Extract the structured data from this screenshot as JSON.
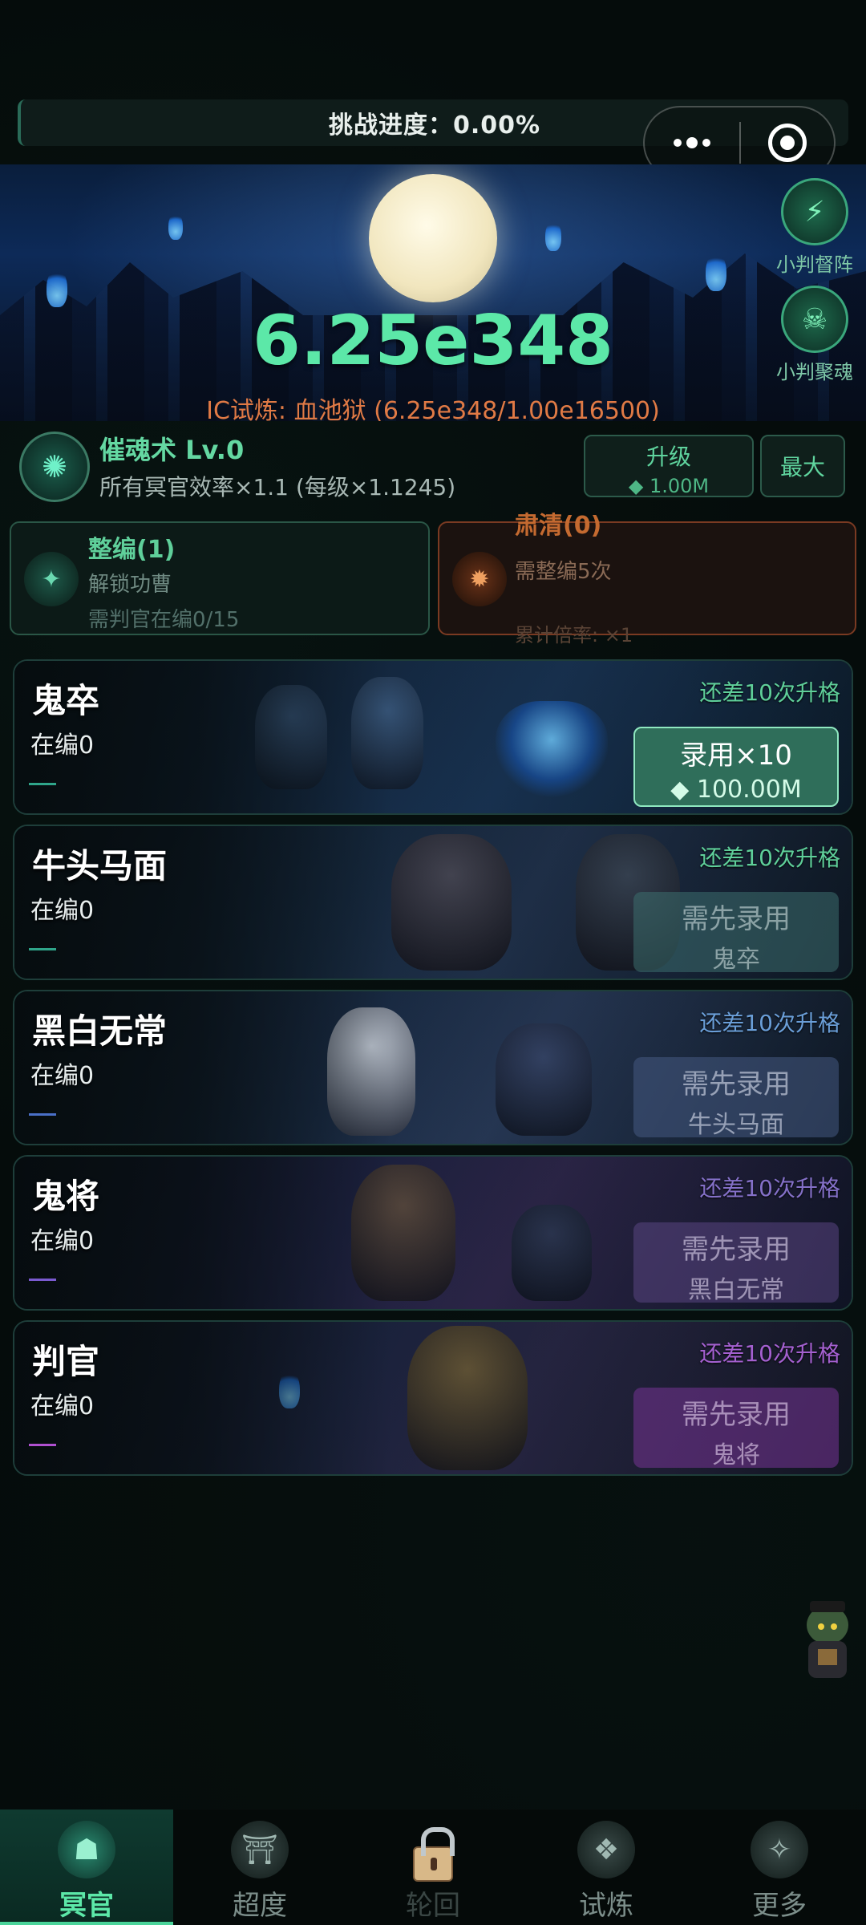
{
  "header": {
    "progress_label": "挑战进度：0.00%"
  },
  "hero": {
    "currency": "6.25e348",
    "trial": "IC试炼: 血池狱 (6.25e348/1.00e16500)",
    "side_buttons": [
      {
        "label": "小判督阵",
        "icon": "lightning-icon"
      },
      {
        "label": "小判聚魂",
        "icon": "soul-skull-icon"
      }
    ]
  },
  "skill": {
    "title": "催魂术 Lv.0",
    "desc": "所有冥官效率×1.1 (每级×1.1245)",
    "upgrade_label": "升级",
    "upgrade_cost": "◆ 1.00M",
    "max_label": "最大"
  },
  "panels": {
    "reorg": {
      "title": "整编(1)",
      "line1": "解锁功曹",
      "line2": "需判官在编0/15"
    },
    "purge": {
      "title": "肃清(0)",
      "line1": "需整编5次",
      "line2": "累计倍率: ×1"
    }
  },
  "cards": [
    {
      "name": "鬼卒",
      "count": "在编0",
      "upgrade_hint": "还差10次升格",
      "action_line1": "录用×10",
      "action_line2": "◆ 100.00M"
    },
    {
      "name": "牛头马面",
      "count": "在编0",
      "upgrade_hint": "还差10次升格",
      "action_line1": "需先录用",
      "action_line2": "鬼卒"
    },
    {
      "name": "黑白无常",
      "count": "在编0",
      "upgrade_hint": "还差10次升格",
      "action_line1": "需先录用",
      "action_line2": "牛头马面"
    },
    {
      "name": "鬼将",
      "count": "在编0",
      "upgrade_hint": "还差10次升格",
      "action_line1": "需先录用",
      "action_line2": "黑白无常"
    },
    {
      "name": "判官",
      "count": "在编0",
      "upgrade_hint": "还差10次升格",
      "action_line1": "需先录用",
      "action_line2": "鬼将"
    }
  ],
  "nav": [
    {
      "label": "冥官",
      "icon": "ghost-officer-icon",
      "active": true
    },
    {
      "label": "超度",
      "icon": "pagoda-icon",
      "active": false
    },
    {
      "label": "轮回",
      "icon": "lock-icon",
      "active": false
    },
    {
      "label": "试炼",
      "icon": "flame-crystal-icon",
      "active": false
    },
    {
      "label": "更多",
      "icon": "more-emblem-icon",
      "active": false
    }
  ]
}
